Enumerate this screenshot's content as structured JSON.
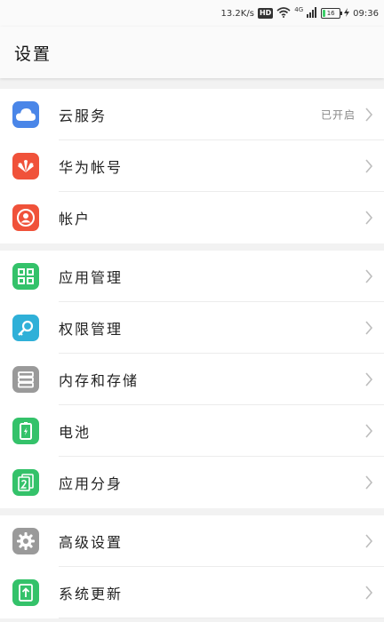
{
  "status_bar": {
    "speed": "13.2K/s",
    "hd": "HD",
    "network": "4G",
    "battery_level": "16",
    "battery_fraction": 0.16,
    "time": "09:36"
  },
  "header": {
    "title": "设置"
  },
  "groups": [
    {
      "items": [
        {
          "label": "云服务",
          "value": "已开启",
          "icon": "cloud-icon",
          "color": "#4a86e8"
        },
        {
          "label": "华为帐号",
          "value": "",
          "icon": "huawei-logo-icon",
          "color": "#f0523a"
        },
        {
          "label": "帐户",
          "value": "",
          "icon": "account-icon",
          "color": "#f0523a"
        }
      ]
    },
    {
      "items": [
        {
          "label": "应用管理",
          "value": "",
          "icon": "app-grid-icon",
          "color": "#34c26a"
        },
        {
          "label": "权限管理",
          "value": "",
          "icon": "key-icon",
          "color": "#2fb0d8"
        },
        {
          "label": "内存和存储",
          "value": "",
          "icon": "storage-icon",
          "color": "#9a9a9a"
        },
        {
          "label": "电池",
          "value": "",
          "icon": "battery-icon",
          "color": "#34c26a"
        },
        {
          "label": "应用分身",
          "value": "",
          "icon": "app-twin-icon",
          "color": "#34c26a"
        }
      ]
    },
    {
      "items": [
        {
          "label": "高级设置",
          "value": "",
          "icon": "gear-icon",
          "color": "#9a9a9a"
        },
        {
          "label": "系统更新",
          "value": "",
          "icon": "system-update-icon",
          "color": "#34c26a"
        }
      ]
    }
  ]
}
